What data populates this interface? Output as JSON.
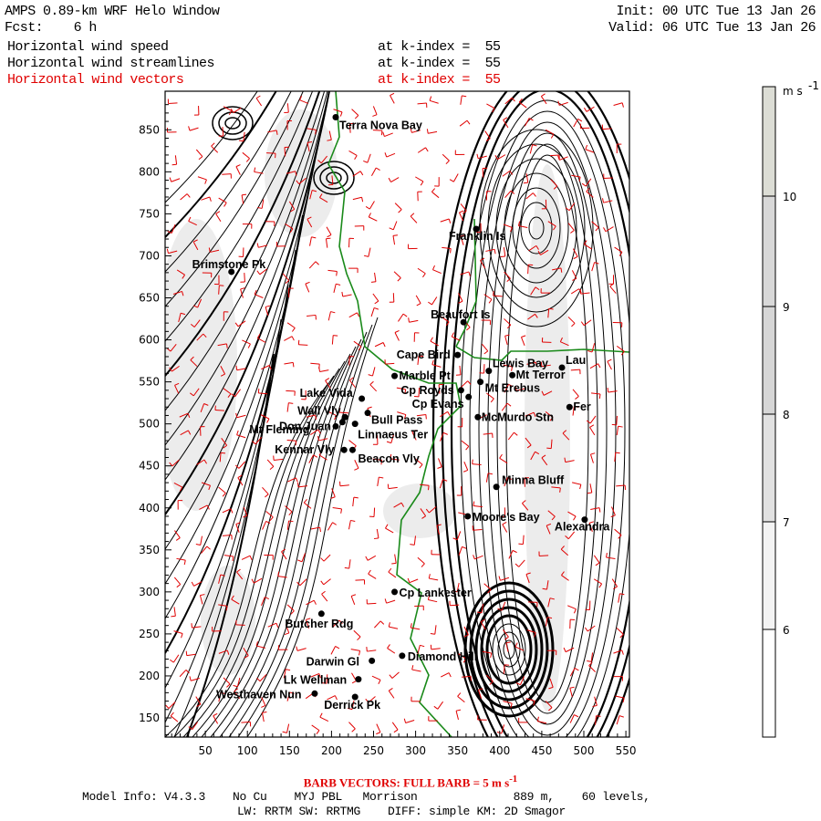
{
  "header": {
    "title": "AMPS 0.89-km WRF Helo Window",
    "fcst": "Fcst:    6 h",
    "init": "Init: 00 UTC Tue 13 Jan 26",
    "valid": "Valid: 06 UTC Tue 13 Jan 26",
    "fields": [
      {
        "name": "Horizontal wind speed",
        "level": "at k-index =  55"
      },
      {
        "name": "Horizontal wind streamlines",
        "level": "at k-index =  55"
      },
      {
        "name": "Horizontal wind vectors",
        "level": "at k-index =  55"
      }
    ]
  },
  "footer": {
    "barb_note": "BARB VECTORS:  FULL BARB = 5 m s",
    "barb_note_exp": "-1",
    "model_line1": "Model Info: V4.3.3    No Cu    MYJ PBL   Morrison              889 m,    60 levels,",
    "model_line2": "LW: RRTM SW: RRTMG    DIFF: simple KM: 2D Smagor"
  },
  "colors": {
    "streamline": "#000000",
    "barb": "#e00000",
    "coast": "#1a8a1a"
  },
  "chart_data": {
    "type": "map",
    "xlim": [
      0,
      555
    ],
    "ylim": [
      125,
      885
    ],
    "x_ticks": [
      50,
      100,
      150,
      200,
      250,
      300,
      350,
      400,
      450,
      500,
      550
    ],
    "y_ticks": [
      150,
      200,
      250,
      300,
      350,
      400,
      450,
      500,
      550,
      600,
      650,
      700,
      750,
      800,
      850
    ],
    "colorbar": {
      "units": "m s",
      "units_exp": "-1",
      "levels": [
        6,
        7,
        8,
        9,
        10
      ],
      "colors": [
        "#ffffff",
        "#f3f3f3",
        "#e1e1e1",
        "#d6d6d6",
        "#d8d8d8",
        "#dcddd5"
      ]
    },
    "stations": [
      {
        "name": "Terra Nova Bay",
        "x": 205,
        "y": 865
      },
      {
        "name": "Franklin Is",
        "x": 372,
        "y": 732
      },
      {
        "name": "Brimstone Pk",
        "x": 81,
        "y": 681
      },
      {
        "name": "Beaufort Is",
        "x": 357,
        "y": 621
      },
      {
        "name": "Cape Bird",
        "x": 350,
        "y": 582
      },
      {
        "name": "Marble Pt",
        "x": 275,
        "y": 557
      },
      {
        "name": "Lewis Bay",
        "x": 387,
        "y": 563
      },
      {
        "name": "Mt Terror",
        "x": 415,
        "y": 558
      },
      {
        "name": "Lau",
        "x": 474,
        "y": 567
      },
      {
        "name": "Cp Royds",
        "x": 354,
        "y": 540
      },
      {
        "name": "Mt Erebus",
        "x": 377,
        "y": 550
      },
      {
        "name": "Fer",
        "x": 483,
        "y": 520
      },
      {
        "name": "Cp Evans",
        "x": 363,
        "y": 532
      },
      {
        "name": "McMurdo Stn",
        "x": 374,
        "y": 508
      },
      {
        "name": "Lake Vida",
        "x": 236,
        "y": 530
      },
      {
        "name": "Wall Vly",
        "x": 216,
        "y": 508
      },
      {
        "name": "Bull Pass",
        "x": 243,
        "y": 513
      },
      {
        "name": "Don Juan",
        "x": 205,
        "y": 497
      },
      {
        "name": "Mt Fleming",
        "x": 213,
        "y": 502
      },
      {
        "name": "Linnaeus Ter",
        "x": 228,
        "y": 500
      },
      {
        "name": "Kennar Vly",
        "x": 215,
        "y": 469
      },
      {
        "name": "Beacon Vly",
        "x": 225,
        "y": 469
      },
      {
        "name": "Minna Bluff",
        "x": 396,
        "y": 425
      },
      {
        "name": "Moore's Bay",
        "x": 362,
        "y": 390
      },
      {
        "name": "Alexandra",
        "x": 501,
        "y": 386
      },
      {
        "name": "Cp Lankester",
        "x": 275,
        "y": 300
      },
      {
        "name": "Butcher Rdg",
        "x": 188,
        "y": 274
      },
      {
        "name": "Darwin Gl",
        "x": 248,
        "y": 218
      },
      {
        "name": "Diamond Hill",
        "x": 284,
        "y": 224
      },
      {
        "name": "Lk Wellman",
        "x": 232,
        "y": 196
      },
      {
        "name": "Westhaven Nun",
        "x": 180,
        "y": 179
      },
      {
        "name": "Derrick Pk",
        "x": 228,
        "y": 175
      }
    ]
  }
}
